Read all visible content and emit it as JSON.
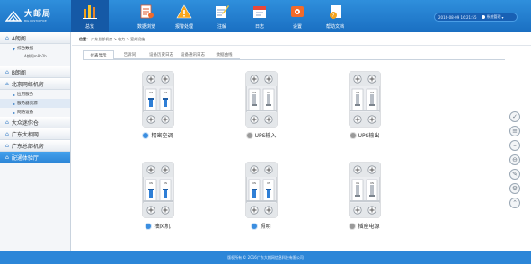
{
  "brand": {
    "name_cn": "大邮局",
    "name_en": "BIG POSTOFFICE"
  },
  "nav": [
    {
      "label": "总览",
      "icon": "overview-icon"
    },
    {
      "label": "数据浏览",
      "icon": "data-browse-icon"
    },
    {
      "label": "报警处理",
      "icon": "alarm-icon"
    },
    {
      "label": "注解",
      "icon": "annotation-icon"
    },
    {
      "label": "日志",
      "icon": "log-icon"
    },
    {
      "label": "设置",
      "icon": "settings-icon"
    },
    {
      "label": "帮助文档",
      "icon": "help-doc-icon"
    }
  ],
  "top_right": {
    "datetime": "2016-08-09 16:21:55",
    "user": "系统管理"
  },
  "sidebar": {
    "sections": [
      {
        "label": "A朗阁"
      },
      {
        "label": "综合数据"
      },
      {
        "label": "A朗阁m8b2h"
      },
      {
        "label": "B朗阁"
      },
      {
        "label": "北京网络机房"
      },
      {
        "label": "应用服务"
      },
      {
        "label": "服务器资源"
      },
      {
        "label": "网络设备"
      },
      {
        "label": "大众迷你仓"
      },
      {
        "label": "广东大相网"
      },
      {
        "label": "广东总部机房"
      },
      {
        "label": "配通体验厅"
      }
    ]
  },
  "breadcrumb": {
    "prefix": "位置：",
    "path": "广东总部机房 > 电力 > 室外设施"
  },
  "tabs": [
    "仪表显示",
    "告诉同",
    "设备历史日志",
    "设备通讯日志",
    "数据曲线"
  ],
  "devices": [
    {
      "label": "精密空调",
      "status": "on",
      "status_color": "#3b8ee0"
    },
    {
      "label": "UPS输入",
      "status": "off",
      "status_color": "#9a9a9a"
    },
    {
      "label": "UPS输出",
      "status": "off",
      "status_color": "#9a9a9a"
    },
    {
      "label": "抽风机",
      "status": "on",
      "status_color": "#3b8ee0"
    },
    {
      "label": "照明",
      "status": "on",
      "status_color": "#3b8ee0"
    },
    {
      "label": "插座电源",
      "status": "off",
      "status_color": "#9a9a9a"
    }
  ],
  "switch_text": {
    "on": "ON",
    "off": "ON"
  },
  "right_tools": [
    "check-icon",
    "list-icon",
    "minus-icon",
    "remove-icon",
    "edit-icon",
    "gear-icon",
    "scroll-top-icon"
  ],
  "footer": {
    "text": "版权所有  © 2016广东大相网信息科技有限公司"
  }
}
